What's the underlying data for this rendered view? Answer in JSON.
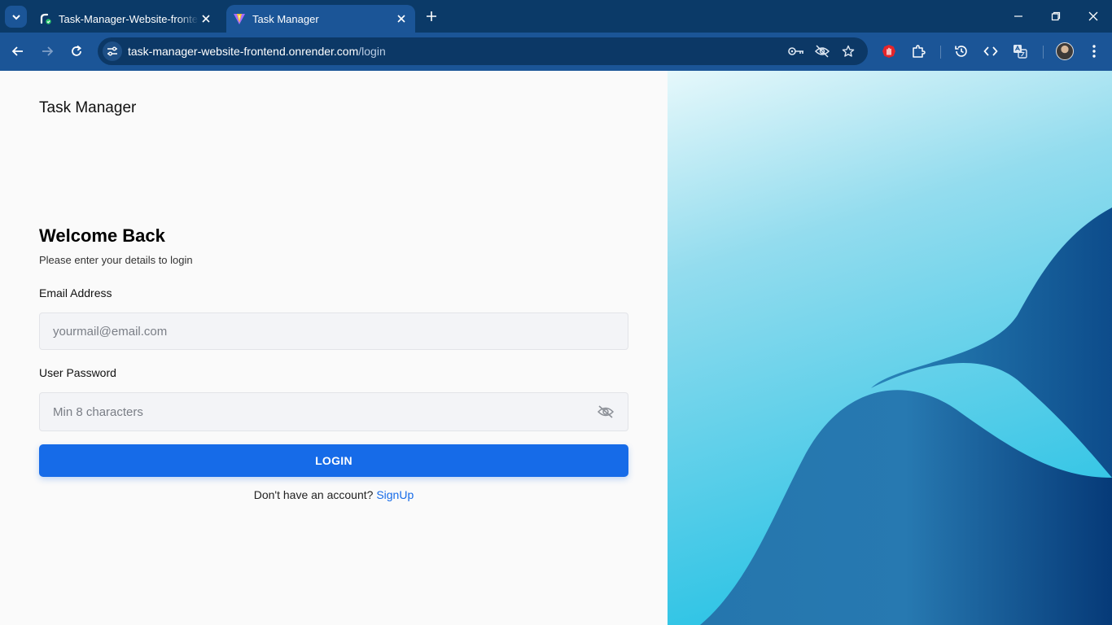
{
  "browser": {
    "tabs": [
      {
        "title": "Task-Manager-Website-frontend",
        "active": false
      },
      {
        "title": "Task Manager",
        "active": true
      }
    ],
    "url_host": "task-manager-website-frontend.onrender.com",
    "url_path": "/login"
  },
  "page": {
    "brand": "Task Manager",
    "heading": "Welcome Back",
    "subtitle": "Please enter your details to login",
    "email": {
      "label": "Email Address",
      "placeholder": "yourmail@email.com",
      "value": ""
    },
    "password": {
      "label": "User Password",
      "placeholder": "Min 8 characters",
      "value": ""
    },
    "login_button": "LOGIN",
    "signup_prompt": "Don't have an account?",
    "signup_link": "SignUp"
  },
  "colors": {
    "primary": "#166be8",
    "tab_strip": "#0b3a68",
    "toolbar": "#1b5597",
    "art_light": "#2fc4e4",
    "art_dark": "#0b3f82"
  },
  "icons": {
    "tab_search": "chevron-down-icon",
    "inactive_tab_favicon": "render-icon",
    "active_tab_favicon": "vite-icon",
    "password_toggle": "eye-off-icon",
    "extensions": [
      "key-icon",
      "eye-off-icon",
      "star-icon",
      "hand-stop-icon",
      "puzzle-icon",
      "history-icon",
      "code-icon",
      "translate-icon"
    ]
  }
}
